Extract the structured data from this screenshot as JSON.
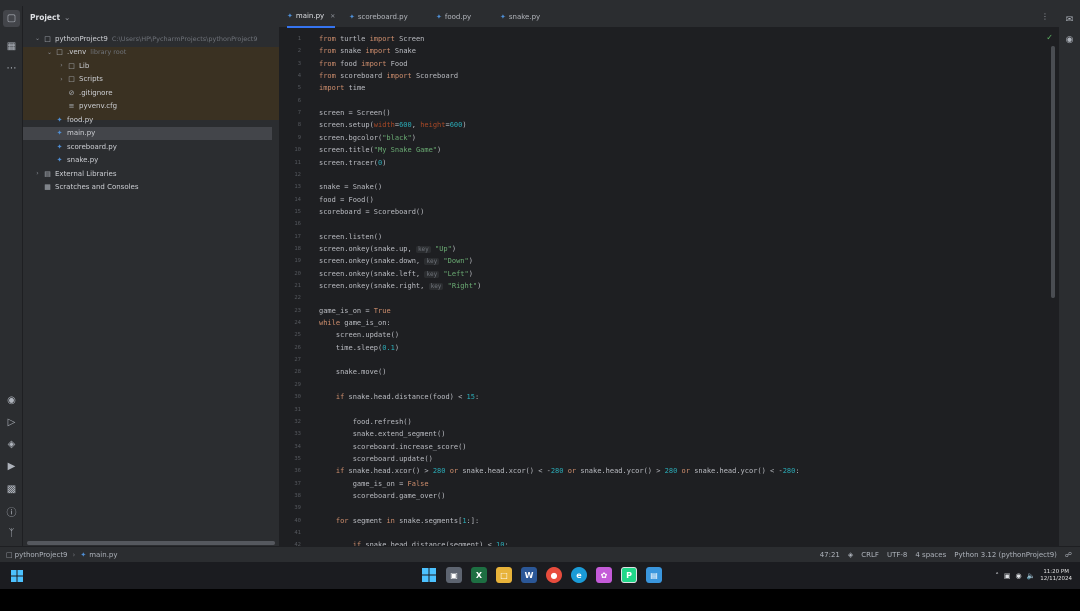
{
  "project_panel": {
    "title": "Project",
    "tree": [
      {
        "label": "pythonProject9",
        "hint": "C:\\Users\\HP\\PycharmProjects\\pythonProject9",
        "type": "folder",
        "depth": 0,
        "arrow": "v"
      },
      {
        "label": ".venv",
        "hint": "library root",
        "type": "folder",
        "depth": 1,
        "arrow": "v"
      },
      {
        "label": "Lib",
        "hint": "",
        "type": "folder",
        "depth": 2,
        "arrow": ">"
      },
      {
        "label": "Scripts",
        "hint": "",
        "type": "folder",
        "depth": 2,
        "arrow": ">"
      },
      {
        "label": ".gitignore",
        "hint": "",
        "type": "ignore",
        "depth": 2,
        "arrow": ""
      },
      {
        "label": "pyvenv.cfg",
        "hint": "",
        "type": "cfg",
        "depth": 2,
        "arrow": ""
      },
      {
        "label": "food.py",
        "hint": "",
        "type": "py",
        "depth": 1,
        "arrow": ""
      },
      {
        "label": "main.py",
        "hint": "",
        "type": "py",
        "depth": 1,
        "arrow": ""
      },
      {
        "label": "scoreboard.py",
        "hint": "",
        "type": "py",
        "depth": 1,
        "arrow": ""
      },
      {
        "label": "snake.py",
        "hint": "",
        "type": "py",
        "depth": 1,
        "arrow": ""
      },
      {
        "label": "External Libraries",
        "hint": "",
        "type": "lib",
        "depth": 0,
        "arrow": ">"
      },
      {
        "label": "Scratches and Consoles",
        "hint": "",
        "type": "scratch",
        "depth": 0,
        "arrow": ""
      }
    ]
  },
  "tabs": [
    {
      "label": "main.py",
      "active": true
    },
    {
      "label": "scoreboard.py",
      "active": false
    },
    {
      "label": "food.py",
      "active": false
    },
    {
      "label": "snake.py",
      "active": false
    }
  ],
  "code_lines": [
    "from turtle import Screen",
    "from snake import Snake",
    "from food import Food",
    "from scoreboard import Scoreboard",
    "import time",
    "",
    "screen = Screen()",
    "screen.setup(width=600, height=600)",
    "screen.bgcolor(\"black\")",
    "screen.title(\"My Snake Game\")",
    "screen.tracer(0)",
    "",
    "snake = Snake()",
    "food = Food()",
    "scoreboard = Scoreboard()",
    "",
    "screen.listen()",
    "screen.onkey(snake.up, key: \"Up\")",
    "screen.onkey(snake.down, key: \"Down\")",
    "screen.onkey(snake.left, key: \"Left\")",
    "screen.onkey(snake.right, key: \"Right\")",
    "",
    "game_is_on = True",
    "while game_is_on:",
    "    screen.update()",
    "    time.sleep(0.1)",
    "",
    "    snake.move()",
    "",
    "    if snake.head.distance(food) < 15:",
    "",
    "        food.refresh()",
    "        snake.extend_segment()",
    "        scoreboard.increase_score()",
    "        scoreboard.update()",
    "    if snake.head.xcor() > 280 or snake.head.xcor() < -280 or snake.head.ycor() > 280 or snake.head.ycor() < -280:",
    "        game_is_on = False",
    "        scoreboard.game_over()",
    "",
    "    for segment in snake.segments[1:]:",
    "",
    "        if snake.head.distance(segment) < 10:"
  ],
  "status_bar": {
    "breadcrumb": [
      "pythonProject9",
      "main.py"
    ],
    "position": "47:21",
    "line_ending": "CRLF",
    "encoding": "UTF-8",
    "indent": "4 spaces",
    "interpreter": "Python 3.12 (pythonProject9)"
  },
  "taskbar": {
    "time": "11:20 PM",
    "date": "12/11/2024"
  },
  "colors": {
    "accent": "#3574f0",
    "keyword": "#cf8e6d",
    "string": "#6aab73",
    "number": "#2aacb8"
  }
}
